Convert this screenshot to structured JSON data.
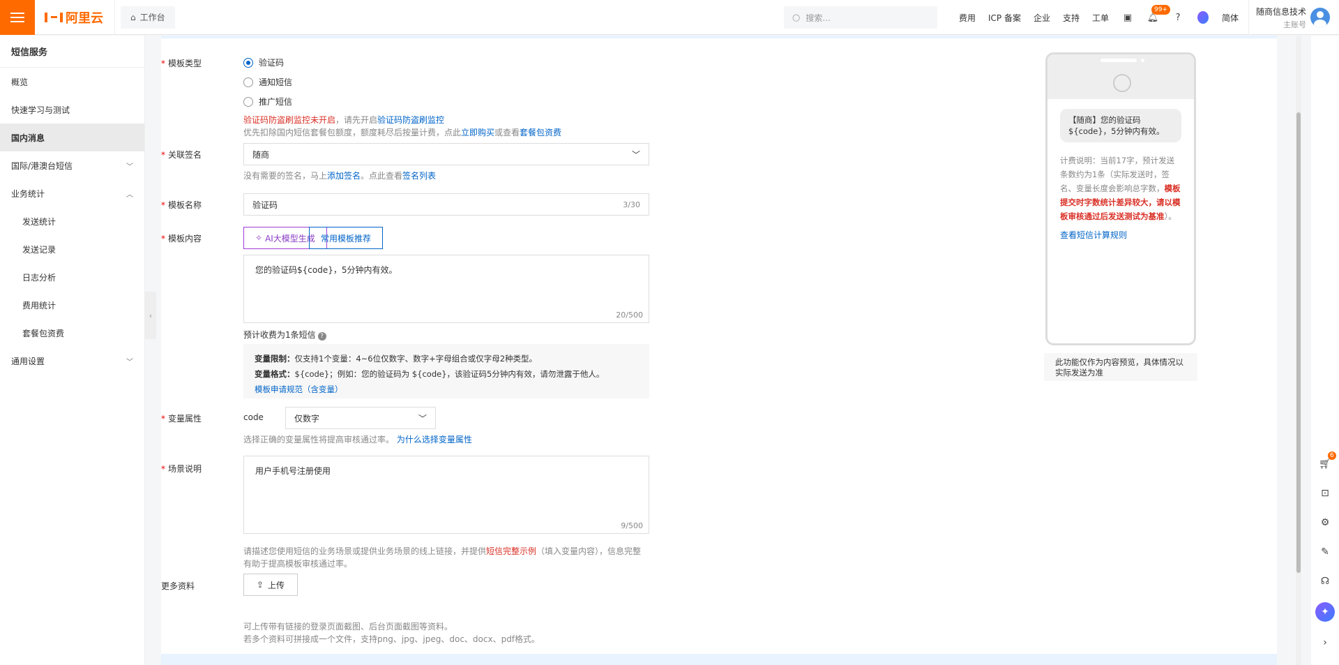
{
  "topbar": {
    "logo_text": "阿里云",
    "workbench": "工作台",
    "search_placeholder": "搜索...",
    "links": [
      "费用",
      "ICP 备案",
      "企业",
      "支持",
      "工单"
    ],
    "notification_badge": "99+",
    "language": "简体",
    "account_name": "随商信息技术",
    "account_role": "主账号"
  },
  "sidebar": {
    "title": "短信服务",
    "items": [
      {
        "label": "概览"
      },
      {
        "label": "快速学习与测试"
      },
      {
        "label": "国内消息"
      },
      {
        "label": "国际/港澳台短信"
      },
      {
        "label": "业务统计"
      },
      {
        "label": "发送统计"
      },
      {
        "label": "发送记录"
      },
      {
        "label": "日志分析"
      },
      {
        "label": "费用统计"
      },
      {
        "label": "套餐包资费"
      },
      {
        "label": "通用设置"
      }
    ]
  },
  "form": {
    "template_type": {
      "label": "模板类型",
      "options": [
        "验证码",
        "通知短信",
        "推广短信"
      ],
      "selected": "验证码",
      "warn_red": "验证码防盗刷监控未开启",
      "warn_mid": "，请先开启",
      "warn_link": "验证码防盗刷监控",
      "note_a": "优先扣除国内短信套餐包额度，额度耗尽后按量计费，点此",
      "note_link1": "立即购买",
      "note_b": "或查看",
      "note_link2": "套餐包资费"
    },
    "signature": {
      "label": "关联签名",
      "value": "随商",
      "hint_a": "没有需要的签名，马上",
      "hint_link1": "添加签名",
      "hint_b": "。点此查看",
      "hint_link2": "签名列表"
    },
    "template_name": {
      "label": "模板名称",
      "value": "验证码",
      "counter": "3/30"
    },
    "template_content": {
      "label": "模板内容",
      "ai_button": "AI大模型生成",
      "common_button": "常用模板推荐",
      "value": "您的验证码${code}，5分钟内有效。",
      "counter": "20/500",
      "estimate": "预计收费为1条短信",
      "info_label1": "变量限制：",
      "info_text1": "仅支持1个变量：4~6位仅数字、数字+字母组合或仅字母2种类型。",
      "info_label2": "变量格式：",
      "info_text2": "${code}；例如：您的验证码为 ${code}，该验证码5分钟内有效，请勿泄露于他人。",
      "info_link": "模板申请规范（含变量）"
    },
    "variable": {
      "label": "变量属性",
      "name": "code",
      "type_value": "仅数字",
      "hint": "选择正确的变量属性将提高审核通过率。",
      "hint_link": "为什么选择变量属性"
    },
    "scenario": {
      "label": "场景说明",
      "value": "用户手机号注册使用",
      "counter": "9/500",
      "hint_a": "请描述您使用短信的业务场景或提供业务场景的线上链接，并提供",
      "hint_red": "短信完整示例",
      "hint_b": "（填入变量内容），信息完整",
      "hint_c": "有助于提高模板审核通过率。"
    },
    "more": {
      "label": "更多资料",
      "upload_button": "上传",
      "hint1": "可上传带有链接的登录页面截图、后台页面截图等资料。",
      "hint2": "若多个资料可拼接成一个文件，支持png、jpg、jpeg、doc、docx、pdf格式。"
    }
  },
  "preview": {
    "bubble": "【随商】您的验证码${code}，5分钟内有效。",
    "note_a": "计费说明：当前17字，预计发送条数约为1条（实际发送时，签名、变量长度会影响总字数，",
    "note_red": "模板提交时字数统计差异较大，请以模板审核通过后发送测试为基准",
    "note_b": "）。",
    "link": "查看短信计算规则",
    "disclaimer": "此功能仅作为内容预览，具体情况以实际发送为准"
  },
  "rail": {
    "cart_badge": "6"
  }
}
